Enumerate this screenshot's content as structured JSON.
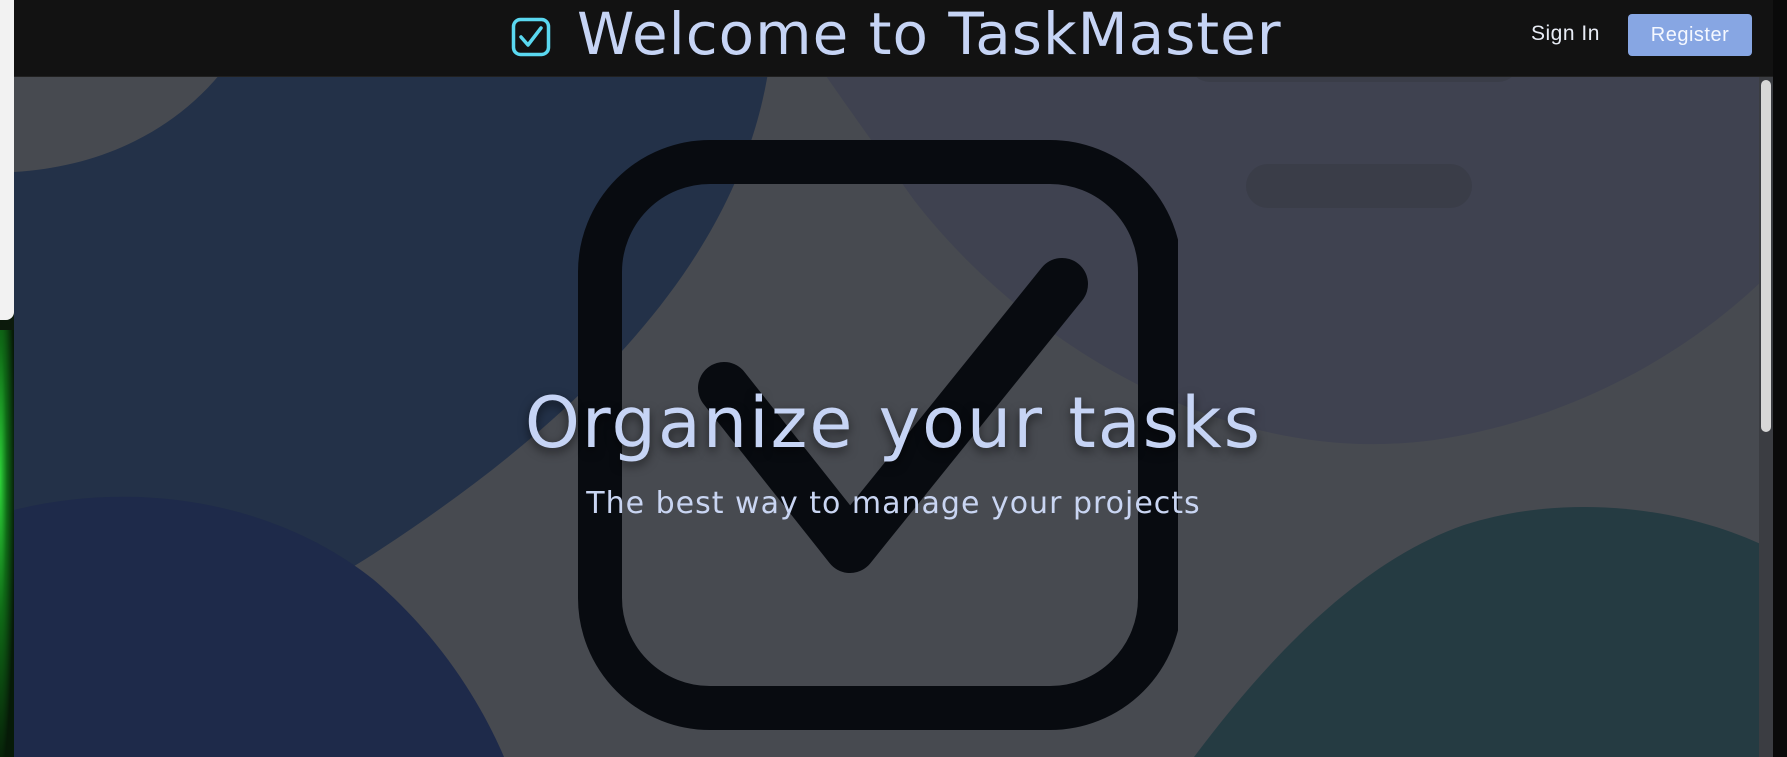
{
  "header": {
    "title": "Welcome to TaskMaster",
    "logo_icon": "checkbox-icon",
    "sign_in_label": "Sign In",
    "register_label": "Register"
  },
  "hero": {
    "heading": "Organize your tasks",
    "subheading": "The best way to manage your projects",
    "illustration_icon": "checkbox-check-icon"
  },
  "colors": {
    "accent": "#87a6e3",
    "title_text": "#c6d4f5",
    "logo_icon": "#5ad8f0",
    "navbar_bg": "#121212",
    "hero_bg": "#474a50"
  }
}
